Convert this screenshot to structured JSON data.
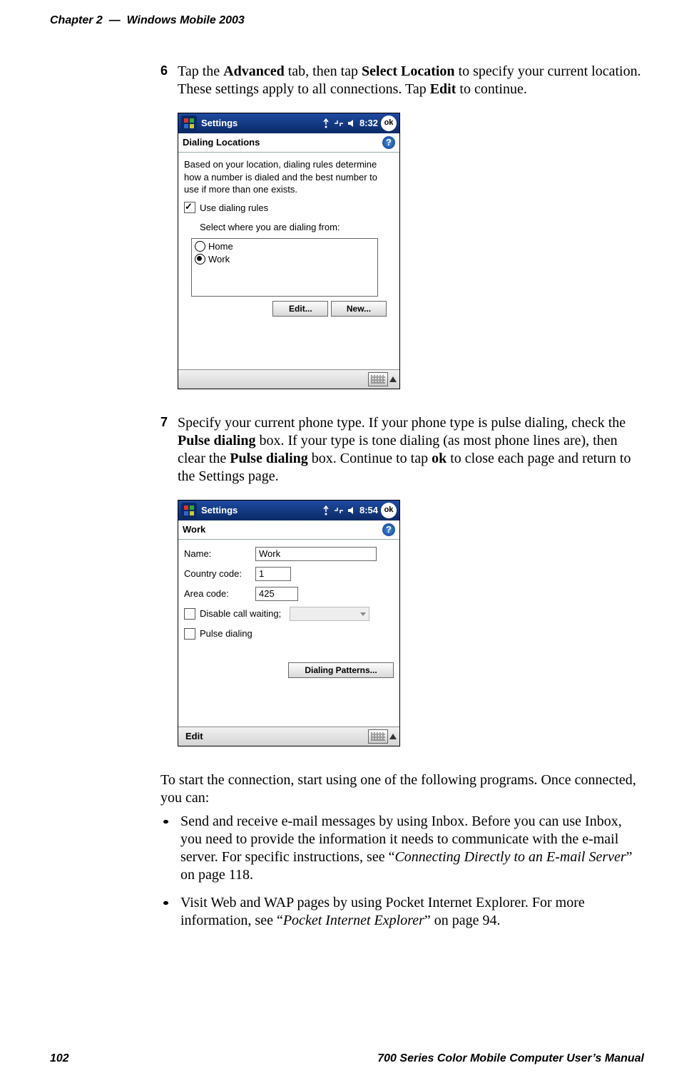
{
  "header": {
    "left_chapter": "Chapter 2",
    "left_sep": "—",
    "left_title": "Windows Mobile 2003"
  },
  "step6": {
    "num": "6",
    "t1": "Tap the ",
    "b1": "Advanced",
    "t2": " tab, then tap ",
    "b2": "Select Location",
    "t3": " to specify your current location. These settings apply to all connections. Tap ",
    "b3": "Edit",
    "t4": " to continue."
  },
  "shot1": {
    "app": "Settings",
    "time": "8:32",
    "ok": "ok",
    "subtitle": "Dialing Locations",
    "help": "?",
    "desc": "Based on your location, dialing rules determine how a number is dialed and the best number to use if more than one exists.",
    "cb_label": "Use dialing rules",
    "sel_label": "Select where you are dialing from:",
    "opt_home": "Home",
    "opt_work": "Work",
    "btn_edit": "Edit...",
    "btn_new": "New..."
  },
  "step7": {
    "num": "7",
    "t1": "Specify your current phone type. If your phone type is pulse dialing, check the ",
    "b1": "Pulse dialing",
    "t2": " box. If your type is tone dialing (as most phone lines are), then clear the ",
    "b2": "Pulse dialing",
    "t3": " box. Continue to tap ",
    "b3": "ok",
    "t4": " to close each page and return to the Settings page."
  },
  "shot2": {
    "app": "Settings",
    "time": "8:54",
    "ok": "ok",
    "subtitle": "Work",
    "help": "?",
    "lbl_name": "Name:",
    "val_name": "Work",
    "lbl_cc": "Country code:",
    "val_cc": "1",
    "lbl_area": "Area code:",
    "val_area": "425",
    "cb_disable": "Disable call waiting;",
    "cb_pulse": "Pulse dialing",
    "btn_patterns": "Dialing Patterns...",
    "menu_edit": "Edit"
  },
  "closing": {
    "para": "To start the connection, start using one of the following programs. Once connected, you can:",
    "bullet1_a": "Send and receive e-mail messages by using Inbox. Before you can use Inbox, you need to provide the information it needs to communicate with the e-mail server. For specific instructions, see “",
    "bullet1_i": "Connecting Directly to an E-mail Server",
    "bullet1_b": "” on page 118.",
    "bullet2_a": "Visit Web and WAP pages by using Pocket Internet Explorer. For more information, see “",
    "bullet2_i": "Pocket Internet Explorer",
    "bullet2_b": "” on page 94."
  },
  "footer": {
    "page": "102",
    "title": "700 Series Color Mobile Computer User’s Manual"
  },
  "chart_data": null
}
